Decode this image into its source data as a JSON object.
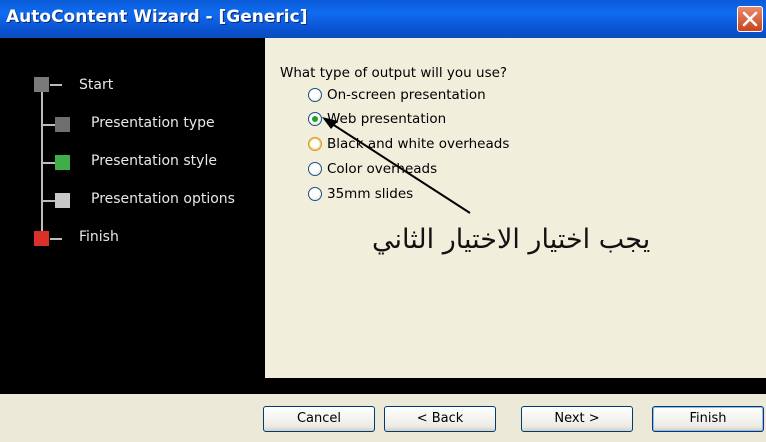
{
  "window": {
    "title": "AutoContent Wizard - [Generic]"
  },
  "steps": [
    {
      "label": "Start",
      "color": "#7a7a7a"
    },
    {
      "label": "Presentation type",
      "color": "#6f6f6f"
    },
    {
      "label": "Presentation style",
      "color": "#3fae49"
    },
    {
      "label": "Presentation options",
      "color": "#c8c8c8"
    },
    {
      "label": "Finish",
      "color": "#d9302a"
    }
  ],
  "question": "What type of output will you use?",
  "options": [
    {
      "label": "On-screen presentation",
      "selected": false
    },
    {
      "label": "Web presentation",
      "selected": true
    },
    {
      "label": "Black and white overheads",
      "selected": false
    },
    {
      "label": "Color overheads",
      "selected": false
    },
    {
      "label": "35mm slides",
      "selected": false
    }
  ],
  "annotation": {
    "text": "يجب اختيار الاختيار الثاني"
  },
  "buttons": {
    "cancel": "Cancel",
    "back": "< Back",
    "next": "Next >",
    "finish": "Finish"
  },
  "icons": {
    "close": "close-icon",
    "arrow": "annotation-arrow"
  }
}
